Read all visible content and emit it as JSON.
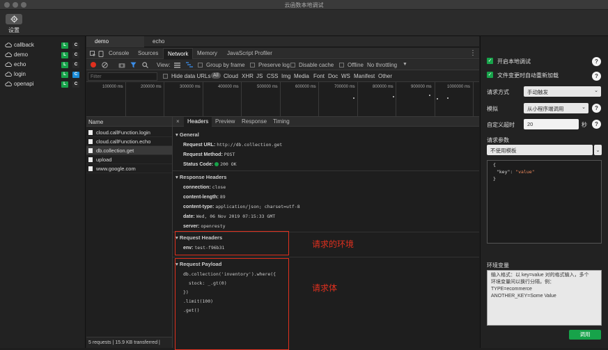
{
  "window": {
    "title": "云函数本地调试"
  },
  "toolbar": {
    "settings_label": "设置"
  },
  "sidebar": {
    "items": [
      {
        "name": "callback",
        "l": "L",
        "c": "C",
        "c_active": false
      },
      {
        "name": "demo",
        "l": "L",
        "c": "C",
        "c_active": false
      },
      {
        "name": "echo",
        "l": "L",
        "c": "C",
        "c_active": false
      },
      {
        "name": "login",
        "l": "L",
        "c": "C",
        "c_active": true
      },
      {
        "name": "openapi",
        "l": "L",
        "c": "C",
        "c_active": false
      }
    ]
  },
  "file_tabs": [
    "demo",
    "echo"
  ],
  "devtools_tabs": [
    "Console",
    "Sources",
    "Network",
    "Memory",
    "JavaScript Profiler"
  ],
  "net_toolbar": {
    "view_label": "View:",
    "group_by_frame": "Group by frame",
    "preserve_log": "Preserve log",
    "disable_cache": "Disable cache",
    "offline": "Offline",
    "throttling": "No throttling"
  },
  "filter_bar": {
    "placeholder": "Filter",
    "hide_data_urls": "Hide data URLs",
    "types": [
      "All",
      "Cloud",
      "XHR",
      "JS",
      "CSS",
      "Img",
      "Media",
      "Font",
      "Doc",
      "WS",
      "Manifest",
      "Other"
    ]
  },
  "timeline": {
    "ticks": [
      "100000 ms",
      "200000 ms",
      "300000 ms",
      "400000 ms",
      "500000 ms",
      "600000 ms",
      "700000 ms",
      "800000 ms",
      "900000 ms",
      "1000000 ms"
    ]
  },
  "requests": {
    "header": "Name",
    "items": [
      "cloud.callFunction.login",
      "cloud.callFunction.echo",
      "db.collection.get",
      "upload",
      "www.google.com"
    ],
    "selected_index": 2,
    "status": "5 requests | 15.9 KB transferred |"
  },
  "detail_tabs": [
    "Headers",
    "Preview",
    "Response",
    "Timing"
  ],
  "general": {
    "title": "General",
    "request_url_k": "Request URL:",
    "request_url_v": "http://db.collection.get",
    "request_method_k": "Request Method:",
    "request_method_v": "POST",
    "status_code_k": "Status Code:",
    "status_code_v": "200 OK"
  },
  "response_headers": {
    "title": "Response Headers",
    "rows": [
      {
        "k": "connection:",
        "v": "close"
      },
      {
        "k": "content-length:",
        "v": "89"
      },
      {
        "k": "content-type:",
        "v": "application/json; charset=utf-8"
      },
      {
        "k": "date:",
        "v": "Wed, 06 Nov 2019 07:15:33 GMT"
      },
      {
        "k": "server:",
        "v": "openresty"
      }
    ]
  },
  "request_headers": {
    "title": "Request Headers",
    "k": "env:",
    "v": "test-f96b31"
  },
  "request_payload": {
    "title": "Request Payload",
    "lines": [
      "db.collection('inventory').where({",
      "  stock: _.gt(0)",
      "})",
      ".limit(100)",
      ".get()"
    ]
  },
  "annotations": {
    "env": "请求的环境",
    "body": "请求体"
  },
  "right_panel": {
    "enable_local_debug": "开启本地调试",
    "auto_reload": "文件变更时自动重新加载",
    "request_method_label": "请求方式",
    "request_method_value": "手动触发",
    "simulate_label": "模拟",
    "simulate_value": "从小程序端调用",
    "timeout_label": "自定义超时",
    "timeout_value": "20",
    "timeout_unit": "秒",
    "params_label": "请求参数",
    "template_value": "不使用模板",
    "json_lines": [
      "{",
      "  \"key\": \"value\"",
      "}"
    ],
    "env_vars_label": "环境变量",
    "env_vars_text": [
      "输入格式：以 key=value 对的格式输入，多个",
      "环境变量间以换行分隔，例：",
      "TYPE=ecommerce",
      "ANOTHER_KEY=Some Value"
    ],
    "invoke_button": "调用",
    "help_glyph": "?"
  },
  "colors": {
    "accent_green": "#17a34a",
    "annotation_red": "#e0301e",
    "link_blue": "#1a8cd8"
  }
}
